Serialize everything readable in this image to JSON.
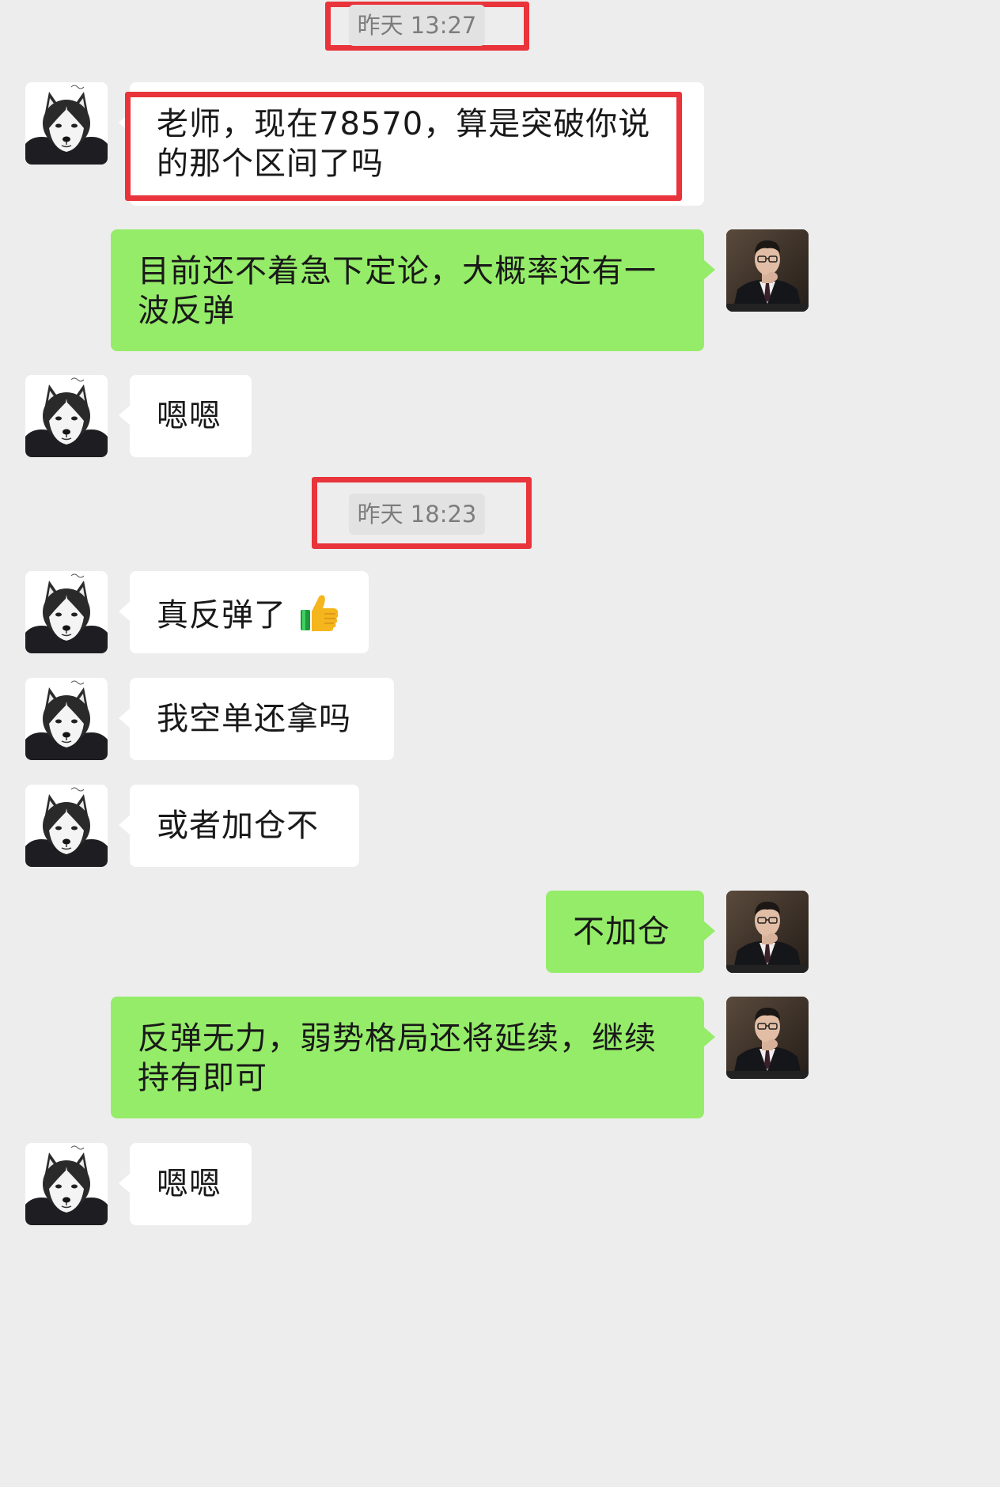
{
  "chat": {
    "timestamps": [
      {
        "text": "昨天 13:27"
      },
      {
        "text": "昨天 18:23"
      }
    ],
    "messages": [
      {
        "sender": "user",
        "text": "老师，现在78570，算是突破你说的那个区间了吗"
      },
      {
        "sender": "teacher",
        "text": "目前还不着急下定论，大概率还有一波反弹"
      },
      {
        "sender": "user",
        "text": "嗯嗯"
      },
      {
        "sender": "user",
        "text": "真反弹了",
        "emoji": "thumbs-up-icon"
      },
      {
        "sender": "user",
        "text": "我空单还拿吗"
      },
      {
        "sender": "user",
        "text": "或者加仓不"
      },
      {
        "sender": "teacher",
        "text": "不加仓"
      },
      {
        "sender": "teacher",
        "text": "反弹无力，弱势格局还将延续，继续持有即可"
      },
      {
        "sender": "user",
        "text": "嗯嗯"
      }
    ]
  },
  "colors": {
    "background": "#ededed",
    "incoming_bubble": "#ffffff",
    "outgoing_bubble": "#95ec69",
    "highlight": "#e8343a",
    "timestamp_text": "#7d7d7d"
  },
  "icons": {
    "user_avatar": "husky-dog-avatar",
    "teacher_avatar": "man-in-suit-avatar"
  }
}
